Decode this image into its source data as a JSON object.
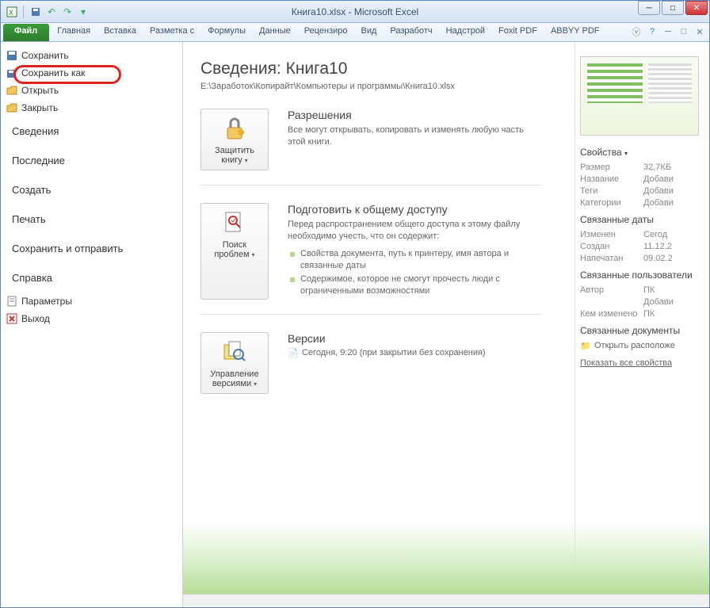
{
  "titlebar": {
    "title": "Книга10.xlsx - Microsoft Excel"
  },
  "win": {
    "min": "─",
    "max": "□",
    "close": "✕"
  },
  "ribbon": {
    "file": "Файл",
    "tabs": [
      "Главная",
      "Вставка",
      "Разметка с",
      "Формулы",
      "Данные",
      "Рецензиро",
      "Вид",
      "Разработч",
      "Надстрой",
      "Foxit PDF",
      "ABBYY PDF"
    ]
  },
  "sidebar": {
    "save": "Сохранить",
    "saveas": "Сохранить как",
    "open": "Открыть",
    "close": "Закрыть",
    "info": "Сведения",
    "recent": "Последние",
    "new": "Создать",
    "print": "Печать",
    "share": "Сохранить и отправить",
    "help": "Справка",
    "options": "Параметры",
    "exit": "Выход"
  },
  "main": {
    "title": "Сведения: Книга10",
    "path": "E:\\Заработок\\Копирайт\\Компьютеры и программы\\Книга10.xlsx",
    "perm": {
      "btn": "Защитить книгу",
      "title": "Разрешения",
      "text": "Все могут открывать, копировать и изменять любую часть этой книги."
    },
    "prep": {
      "btn": "Поиск проблем",
      "title": "Подготовить к общему доступу",
      "text": "Перед распространением общего доступа к этому файлу необходимо учесть, что он содержит:",
      "b1": "Свойства документа, путь к принтеру, имя автора и связанные даты",
      "b2": "Содержимое, которое не смогут прочесть люди с ограниченными возможностями"
    },
    "ver": {
      "btn": "Управление версиями",
      "title": "Версии",
      "v1": "Сегодня, 9:20 (при закрытии без сохранения)"
    }
  },
  "props": {
    "hdr": "Свойства",
    "rows": [
      {
        "k": "Размер",
        "v": "32,7КБ"
      },
      {
        "k": "Название",
        "v": "Добави"
      },
      {
        "k": "Теги",
        "v": "Добави"
      },
      {
        "k": "Категории",
        "v": "Добави"
      }
    ],
    "dates_hdr": "Связанные даты",
    "dates": [
      {
        "k": "Изменен",
        "v": "Сегод"
      },
      {
        "k": "Создан",
        "v": "11.12.2"
      },
      {
        "k": "Напечатан",
        "v": "09.02.2"
      }
    ],
    "users_hdr": "Связанные пользователи",
    "users": [
      {
        "k": "Автор",
        "v": "ПК"
      },
      {
        "k": "",
        "v": "Добави"
      },
      {
        "k": "Кем изменено",
        "v": "ПК"
      }
    ],
    "docs_hdr": "Связанные документы",
    "open_loc": "Открыть расположе",
    "show_all": "Показать все свойства"
  }
}
